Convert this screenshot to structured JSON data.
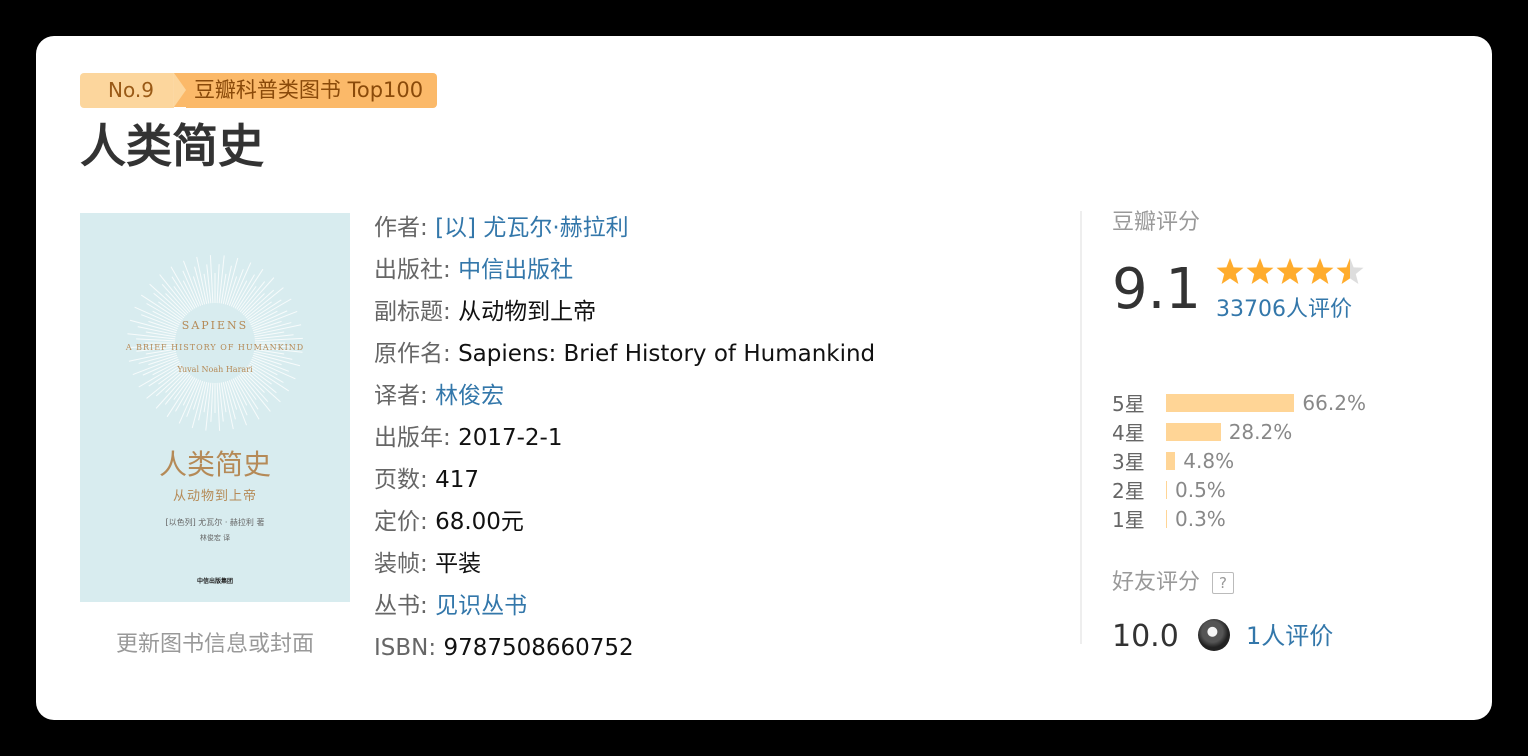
{
  "rank": {
    "no": "No.9",
    "list": "豆瓣科普类图书 Top100"
  },
  "book": {
    "title": "人类简史",
    "cover": {
      "en_title": "SAPIENS",
      "en_subtitle": "A BRIEF HISTORY OF HUMANKIND",
      "en_author": "Yuval Noah Harari",
      "cn_title": "人类简史",
      "cn_subtitle": "从动物到上帝",
      "cn_author": "[以色列] 尤瓦尔 · 赫拉利 著",
      "translator": "林俊宏 译",
      "publisher_mark": "中信出版集团"
    },
    "update_link": "更新图书信息或封面"
  },
  "info": [
    {
      "label": "作者:",
      "value": "[以] 尤瓦尔·赫拉利",
      "link": true
    },
    {
      "label": "出版社:",
      "value": "中信出版社",
      "link": true
    },
    {
      "label": "副标题:",
      "value": "从动物到上帝",
      "link": false
    },
    {
      "label": "原作名:",
      "value": "Sapiens: Brief History of Humankind",
      "link": false
    },
    {
      "label": "译者:",
      "value": "林俊宏",
      "link": true
    },
    {
      "label": "出版年:",
      "value": "2017-2-1",
      "link": false
    },
    {
      "label": "页数:",
      "value": "417",
      "link": false
    },
    {
      "label": "定价:",
      "value": "68.00元",
      "link": false
    },
    {
      "label": "装帧:",
      "value": "平装",
      "link": false
    },
    {
      "label": "丛书:",
      "value": "见识丛书",
      "link": true
    },
    {
      "label": "ISBN:",
      "value": "9787508660752",
      "link": false
    }
  ],
  "rating": {
    "header": "豆瓣评分",
    "score": "9.1",
    "stars": 4.5,
    "votes": "33706人评价",
    "distribution": [
      {
        "label": "5星",
        "percent": 66.2,
        "text": "66.2%"
      },
      {
        "label": "4星",
        "percent": 28.2,
        "text": "28.2%"
      },
      {
        "label": "3星",
        "percent": 4.8,
        "text": "4.8%"
      },
      {
        "label": "2星",
        "percent": 0.5,
        "text": "0.5%"
      },
      {
        "label": "1星",
        "percent": 0.3,
        "text": "0.3%"
      }
    ],
    "friend_header": "好友评分",
    "friend_help": "?",
    "friend_score": "10.0",
    "friend_votes": "1人评价"
  },
  "colors": {
    "link": "#3377aa",
    "star": "#ffac2d",
    "bar": "#ffd596",
    "badge_left": "#fcd69d",
    "badge_right": "#fbb969"
  }
}
